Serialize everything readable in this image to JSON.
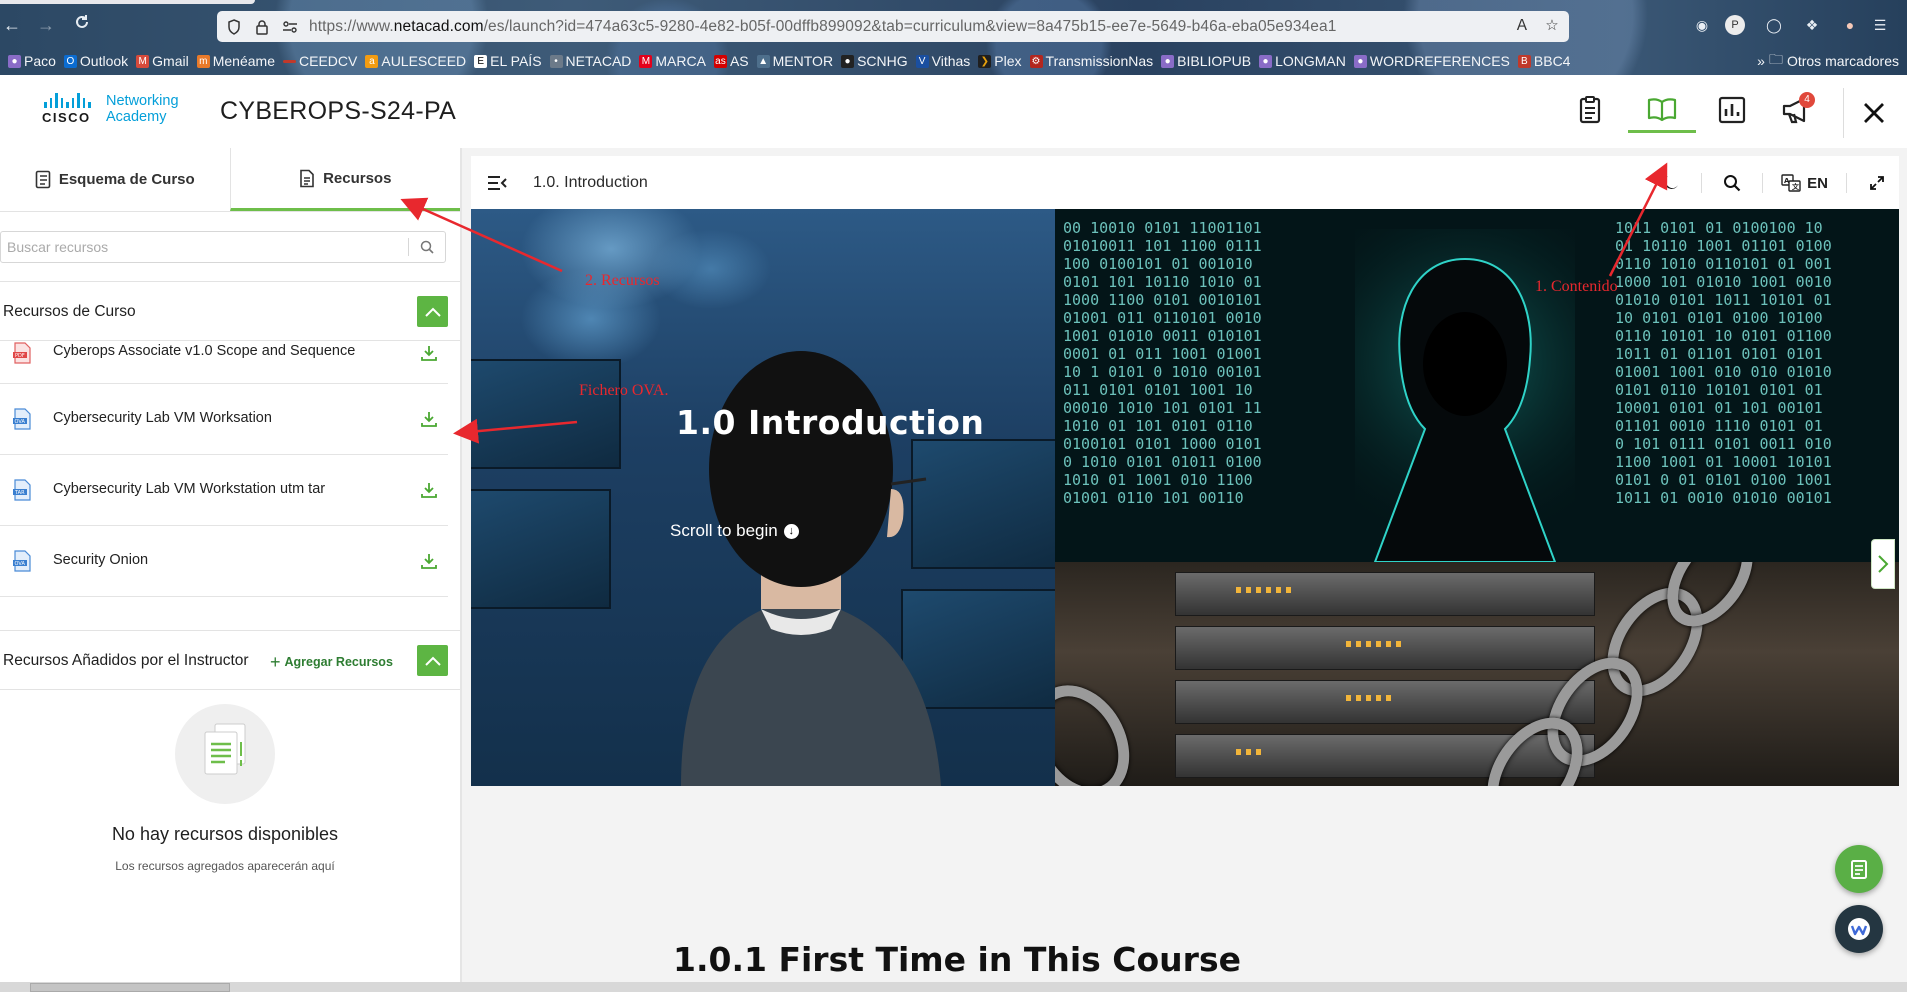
{
  "browser": {
    "url_prefix": "https://www.",
    "url_host": "netacad.com",
    "url_rest": "/es/launch?id=474a63c5-9280-4e82-b05f-00dffb899092&tab=curriculum&view=8a475b15-ee7e-5649-b46a-eba05e934ea1",
    "bookmarks": [
      "Paco",
      "Outlook",
      "Gmail",
      "Menéame",
      "CEEDCV",
      "AULESCEED",
      "EL PAÍS",
      "NETACAD",
      "MARCA",
      "AS",
      "MENTOR",
      "SCNHG",
      "Vithas",
      "Plex",
      "TransmissionNas",
      "BIBLIOPUB",
      "LONGMAN",
      "WORDREFERENCES",
      "BBC4"
    ],
    "bookmarks_other": "Otros marcadores"
  },
  "header": {
    "logo_word": "CISCO",
    "logo_line1": "Networking",
    "logo_line2": "Academy",
    "course_title": "CYBEROPS-S24-PA",
    "notification_count": "4"
  },
  "left_panel": {
    "tabs": [
      {
        "label": "Esquema de Curso"
      },
      {
        "label": "Recursos"
      }
    ],
    "search_placeholder": "Buscar recursos",
    "course_resources_title": "Recursos de Curso",
    "resources": [
      {
        "label": "Cyberops Associate v1.0 Scope and Sequence",
        "file_type": "pdf"
      },
      {
        "label": "Cybersecurity Lab VM Worksation",
        "file_type": "ova"
      },
      {
        "label": "Cybersecurity Lab VM Workstation utm tar",
        "file_type": "tar"
      },
      {
        "label": "Security Onion",
        "file_type": "ova"
      }
    ],
    "instructor_resources_title": "Recursos Añadidos por el Instructor",
    "add_resources_label": "Agregar Recursos",
    "empty_title": "No hay recursos disponibles",
    "empty_subtitle": "Los recursos agregados aparecerán aquí"
  },
  "content": {
    "breadcrumb": "1.0. Introduction",
    "language": "EN",
    "hero_title": "1.0 Introduction",
    "scroll_hint": "Scroll to begin",
    "section_heading": "1.0.1 First Time in This Course"
  },
  "annotations": {
    "contenido": "1. Contenido",
    "recursos": "2. Recursos",
    "fichero": "Fichero OVA."
  },
  "colors": {
    "accent_green": "#6ebe4a",
    "cisco_blue": "#049fd9",
    "annotation_red": "#e8282e"
  }
}
